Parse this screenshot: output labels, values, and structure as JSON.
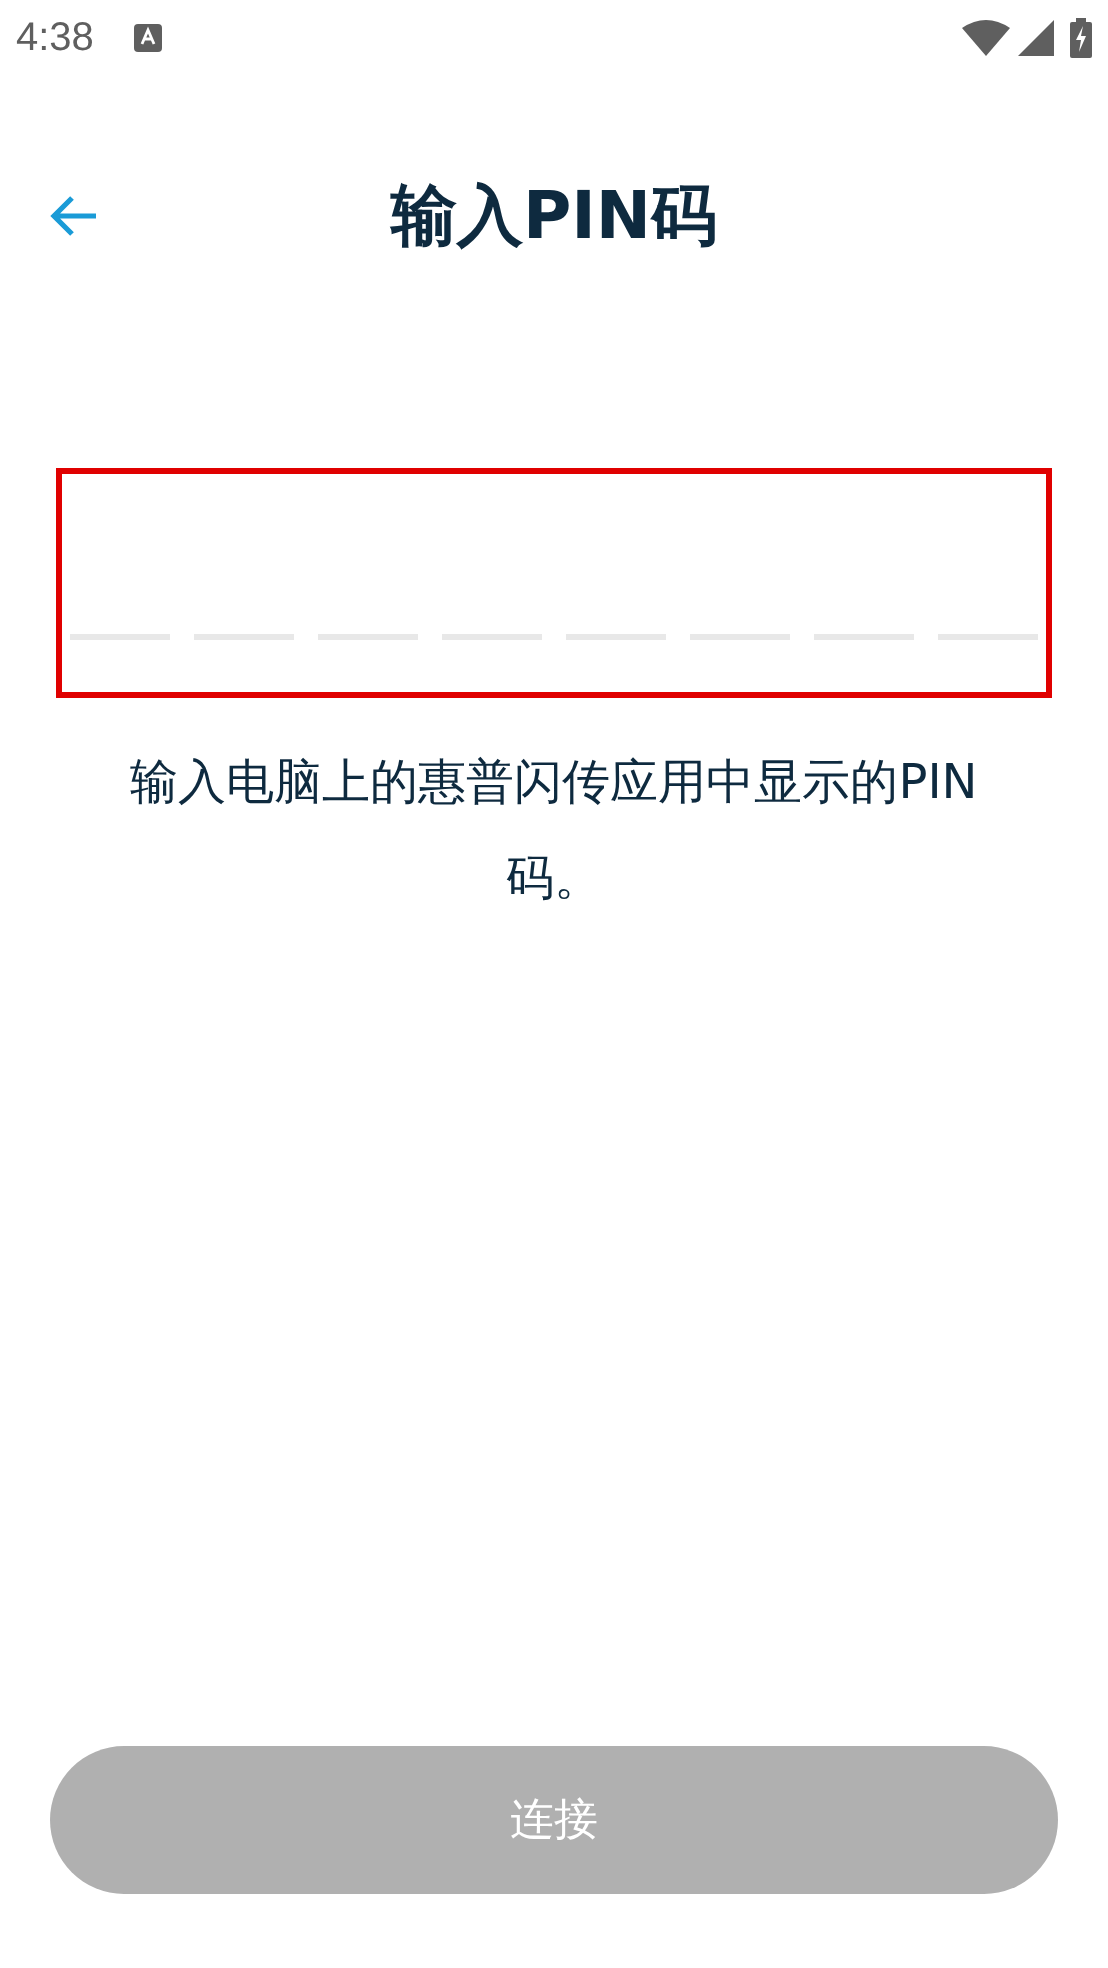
{
  "status_bar": {
    "time": "4:38"
  },
  "header": {
    "title": "输入PIN码"
  },
  "pin": {
    "slots": [
      {
        "filled": false
      },
      {
        "filled": false
      },
      {
        "filled": false
      },
      {
        "filled": false
      },
      {
        "filled": false
      },
      {
        "filled": false
      },
      {
        "filled": false
      },
      {
        "filled": false
      }
    ]
  },
  "instruction": "输入电脑上的惠普闪传应用中显示的PIN码。",
  "connect_button": {
    "label": "连接",
    "disabled": true
  }
}
